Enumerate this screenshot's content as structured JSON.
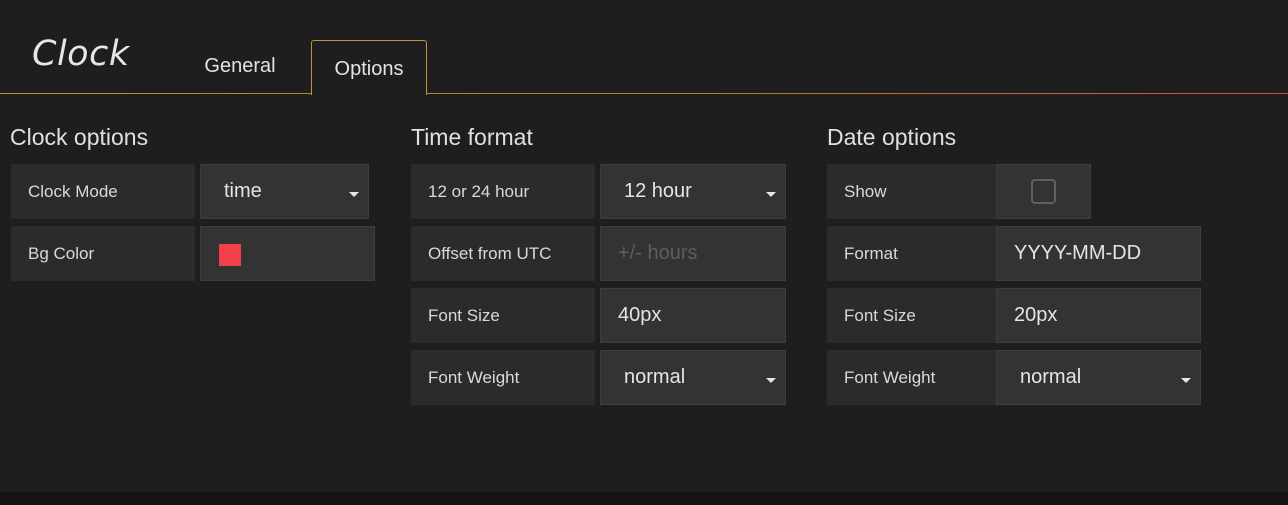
{
  "header": {
    "title": "Clock",
    "tabs": [
      {
        "label": "General",
        "active": false
      },
      {
        "label": "Options",
        "active": true
      }
    ],
    "accent_color": "#c49136"
  },
  "clock_options": {
    "title": "Clock options",
    "clock_mode": {
      "label": "Clock Mode",
      "value": "time"
    },
    "bg_color": {
      "label": "Bg Color",
      "color": "#f2404a"
    }
  },
  "time_format": {
    "title": "Time format",
    "hour_format": {
      "label": "12 or 24 hour",
      "value": "12 hour"
    },
    "offset": {
      "label": "Offset from UTC",
      "value": "",
      "placeholder": "+/- hours"
    },
    "font_size": {
      "label": "Font Size",
      "value": "40px"
    },
    "font_weight": {
      "label": "Font Weight",
      "value": "normal"
    }
  },
  "date_options": {
    "title": "Date options",
    "show": {
      "label": "Show",
      "checked": false
    },
    "format": {
      "label": "Format",
      "value": "YYYY-MM-DD"
    },
    "font_size": {
      "label": "Font Size",
      "value": "20px"
    },
    "font_weight": {
      "label": "Font Weight",
      "value": "normal"
    }
  }
}
